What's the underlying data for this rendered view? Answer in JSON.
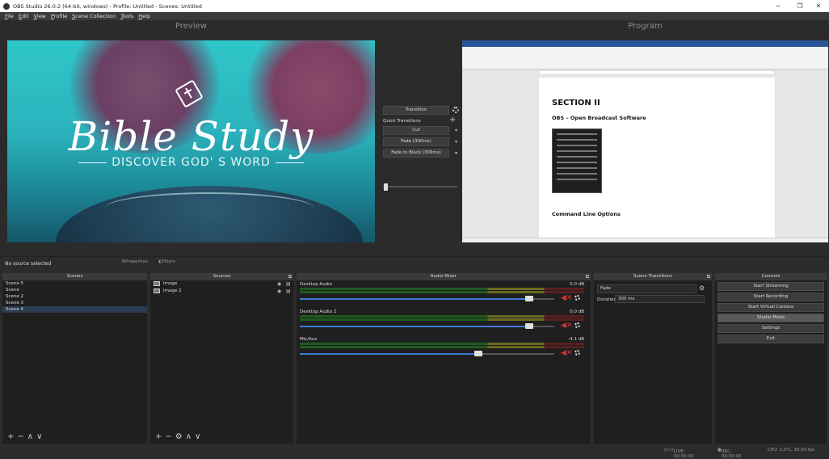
{
  "window": {
    "title": "OBS Studio 26.0.2 (64-bit, windows) - Profile: Untitled - Scenes: Untitled",
    "minimize": "─",
    "restore": "❐",
    "close": "✕"
  },
  "menu": [
    "File",
    "Edit",
    "View",
    "Profile",
    "Scene Collection",
    "Tools",
    "Help"
  ],
  "preview": {
    "label": "Preview",
    "title": "Bible Study",
    "subtitle": "DISCOVER GOD' S WORD"
  },
  "program": {
    "label": "Program",
    "section": "SECTION II",
    "heading": "OBS – Open Broadcast Software",
    "subheading": "Command Line Options"
  },
  "transitions": {
    "transition_btn": "Transition",
    "quick_label": "Quick Transitions",
    "cut": "Cut",
    "fade": "Fade (300ms)",
    "fade_black": "Fade to Black (300ms)"
  },
  "source_bar": {
    "status": "No source selected",
    "properties": "Properties",
    "filters": "Filters"
  },
  "scenes": {
    "header": "Scenes",
    "items": [
      "Scene 5",
      "Scene",
      "Scene 2",
      "Scene 3",
      "Scene 4"
    ],
    "selected_index": 4
  },
  "sources": {
    "header": "Sources",
    "items": [
      "Image",
      "Image 2"
    ]
  },
  "mixer": {
    "header": "Audio Mixer",
    "channels": [
      {
        "name": "Desktop Audio",
        "db": "0.0 dB",
        "volume_fraction": 0.9
      },
      {
        "name": "Desktop Audio 2",
        "db": "0.0 dB",
        "volume_fraction": 0.9
      },
      {
        "name": "Mic/Aux",
        "db": "-4.1 dB",
        "volume_fraction": 0.7
      }
    ],
    "ticks": [
      "-60",
      "-55",
      "-50",
      "-45",
      "-40",
      "-35",
      "-30",
      "-25",
      "-20",
      "-15",
      "-10",
      "-5",
      "0"
    ]
  },
  "scene_transitions": {
    "header": "Scene Transitions",
    "selected": "Fade",
    "duration_label": "Duration",
    "duration": "300 ms"
  },
  "controls": {
    "header": "Controls",
    "buttons": [
      "Start Streaming",
      "Start Recording",
      "Start Virtual Camera",
      "Studio Mode",
      "Settings",
      "Exit"
    ],
    "active_index": 3
  },
  "status": {
    "live": "LIVE: 00:00:00",
    "rec": "REC: 00:00:00",
    "cpu": "CPU: 1.5%, 30.00 fps"
  },
  "colors": {
    "accent": "#3d7ad6",
    "mute": "#d33333",
    "selected": "#2a3c4f"
  }
}
